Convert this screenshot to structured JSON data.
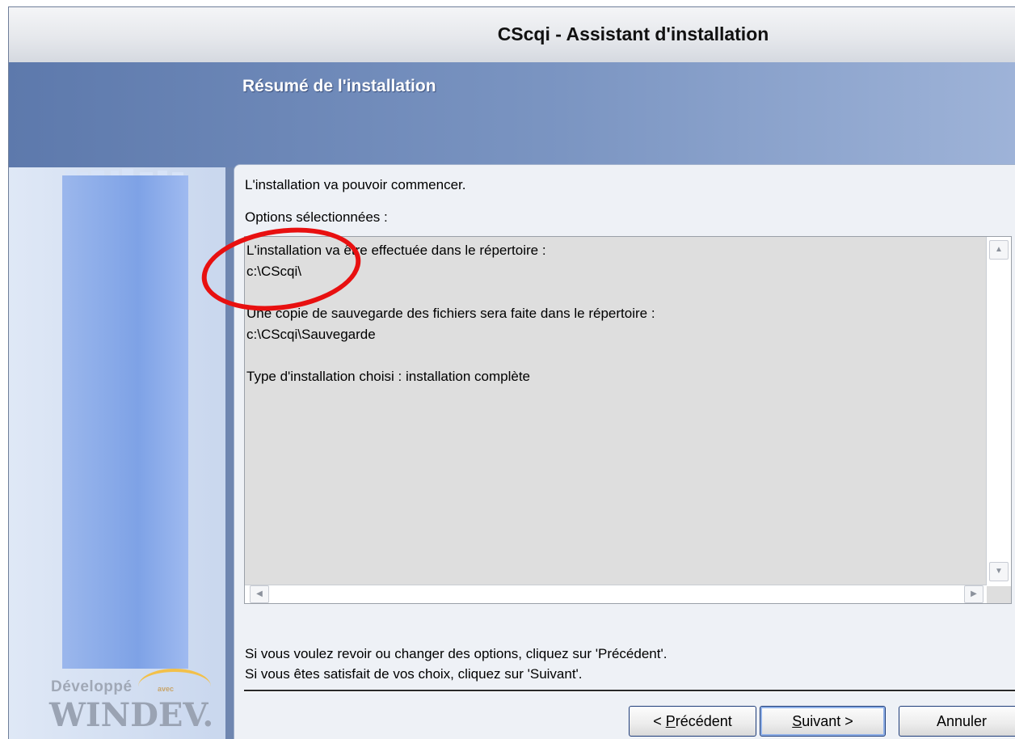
{
  "window": {
    "title": "CScqi - Assistant d'installation"
  },
  "banner": {
    "title": "Résumé de l'installation"
  },
  "content": {
    "intro": "L'installation va pouvoir commencer.",
    "options_label": "Options sélectionnées :",
    "summary_lines": [
      "L'installation va être effectuée dans le répertoire :",
      "c:\\CScqi\\",
      "",
      "Une copie de sauvegarde des fichiers sera faite dans le répertoire :",
      "c:\\CScqi\\Sauvegarde",
      "",
      "Type d'installation choisi : installation complète"
    ],
    "footer_line1": "Si vous voulez revoir ou changer des options, cliquez sur 'Précédent'.",
    "footer_line2": "Si vous êtes satisfait de vos choix, cliquez sur 'Suivant'."
  },
  "buttons": {
    "previous_prefix": "< ",
    "previous_accel": "P",
    "previous_rest": "récédent",
    "next_accel": "S",
    "next_rest": "uivant >",
    "cancel": "Annuler"
  },
  "branding": {
    "developed_label": "Développé",
    "avec_label": "avec",
    "product": "WINDEV."
  },
  "colors": {
    "annotation": "#e81010",
    "banner": "#7b95c2",
    "summary_bg": "#dedede"
  }
}
